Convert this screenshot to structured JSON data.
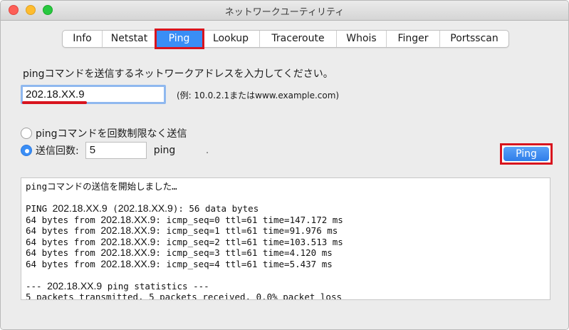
{
  "window": {
    "title": "ネットワークユーティリティ"
  },
  "tabs": [
    {
      "label": "Info",
      "width": 0
    },
    {
      "label": "Netstat"
    },
    {
      "label": "Ping",
      "active": true
    },
    {
      "label": "Lookup"
    },
    {
      "label": "Traceroute"
    },
    {
      "label": "Whois"
    },
    {
      "label": "Finger"
    },
    {
      "label": "Portsscan"
    }
  ],
  "ping": {
    "instruction": "pingコマンドを送信するネットワークアドレスを入力してください。",
    "address_value": "202.18.XX.9",
    "example_hint": "(例: 10.0.2.1またはwww.example.com)",
    "option_unlimited": "pingコマンドを回数制限なく送信",
    "option_count": "送信回数:",
    "count_value": "5",
    "count_unit": "ping",
    "dot": ".",
    "button_label": "Ping"
  },
  "output": {
    "lines": [
      {
        "pre": "pingコマンドの送信を開始しました…",
        "ip": "",
        "post": ""
      },
      {
        "pre": "",
        "ip": "",
        "post": ""
      },
      {
        "pre": "PING ",
        "ip": "202.18.XX.9",
        "mid": " (",
        "ip2": "202.18.XX.9",
        "post": "): 56 data bytes"
      },
      {
        "pre": "64 bytes from ",
        "ip": "202.18.XX.9",
        "post": ": icmp_seq=0 ttl=61 time=147.172 ms"
      },
      {
        "pre": "64 bytes from ",
        "ip": "202.18.XX.9",
        "post": ": icmp_seq=1 ttl=61 time=91.976 ms"
      },
      {
        "pre": "64 bytes from ",
        "ip": "202.18.XX.9",
        "post": ": icmp_seq=2 ttl=61 time=103.513 ms"
      },
      {
        "pre": "64 bytes from ",
        "ip": "202.18.XX.9",
        "post": ": icmp_seq=3 ttl=61 time=4.120 ms"
      },
      {
        "pre": "64 bytes from ",
        "ip": "202.18.XX.9",
        "post": ": icmp_seq=4 ttl=61 time=5.437 ms"
      },
      {
        "pre": "",
        "ip": "",
        "post": ""
      },
      {
        "pre": "--- ",
        "ip": "202.18.XX.9",
        "post": " ping statistics ---"
      },
      {
        "pre": "5 packets transmitted, 5 packets received, 0.0% packet loss",
        "ip": "",
        "post": ""
      }
    ]
  },
  "colors": {
    "accent": "#3a8ef6",
    "highlight": "#d8141e"
  }
}
